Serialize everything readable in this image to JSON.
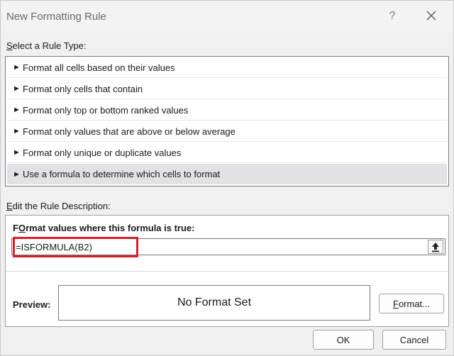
{
  "window": {
    "title": "New Formatting Rule",
    "help_label": "?"
  },
  "rule_type": {
    "label_accel": "S",
    "label_rest": "elect a Rule Type:",
    "arrow_glyph": "►",
    "items": [
      {
        "label": "Format all cells based on their values",
        "selected": false
      },
      {
        "label": "Format only cells that contain",
        "selected": false
      },
      {
        "label": "Format only top or bottom ranked values",
        "selected": false
      },
      {
        "label": "Format only values that are above or below average",
        "selected": false
      },
      {
        "label": "Format only unique or duplicate values",
        "selected": false
      },
      {
        "label": "Use a formula to determine which cells to format",
        "selected": true
      }
    ]
  },
  "description": {
    "label_accel": "E",
    "label_rest": "dit the Rule Description:",
    "formula_label_accel": "O",
    "formula_label_pre": "F",
    "formula_label_rest": "rmat values where this formula is true:",
    "formula_value": "=ISFORMULA(B2)",
    "preview_label": "Preview:",
    "preview_text": "No Format Set",
    "format_button_accel": "F",
    "format_button_rest": "ormat..."
  },
  "footer": {
    "ok_label": "OK",
    "cancel_label": "Cancel"
  },
  "colors": {
    "highlight": "#d9202a",
    "selected_row": "#e2e2e6"
  }
}
